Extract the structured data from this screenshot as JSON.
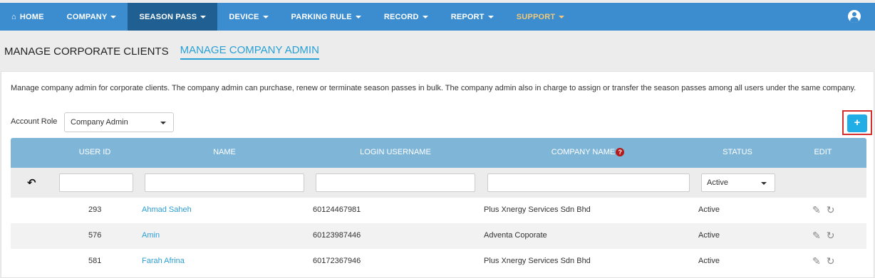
{
  "nav": {
    "items": [
      {
        "label": "HOME",
        "icon": "home-icon"
      },
      {
        "label": "COMPANY"
      },
      {
        "label": "SEASON PASS"
      },
      {
        "label": "DEVICE"
      },
      {
        "label": "PARKING RULE"
      },
      {
        "label": "RECORD"
      },
      {
        "label": "REPORT"
      },
      {
        "label": "SUPPORT"
      }
    ],
    "active": "SEASON PASS",
    "colors": {
      "bar": "#3c8dcf",
      "active": "#1f5f92",
      "support": "#f2c97a"
    }
  },
  "tabs": [
    {
      "label": "MANAGE CORPORATE CLIENTS"
    },
    {
      "label": "MANAGE COMPANY ADMIN"
    }
  ],
  "description": "Manage company admin for corporate clients. The company admin can purchase, renew or terminate season passes in bulk. The company admin also in charge to assign or transfer the season passes among all users under the same company.",
  "filters": {
    "role_label": "Account Role",
    "role_value": "Company Admin",
    "add_button": "+",
    "status_value": "Active"
  },
  "table": {
    "headers": [
      "USER ID",
      "NAME",
      "LOGIN USERNAME",
      "COMPANY NAME",
      "STATUS",
      "EDIT"
    ],
    "rows": [
      {
        "id": "293",
        "name": "Ahmad Saheh",
        "login": "60124467981",
        "company": "Plus Xnergy Services Sdn Bhd",
        "status": "Active"
      },
      {
        "id": "576",
        "name": "Amin",
        "login": "60123987446",
        "company": "Adventa Coporate",
        "status": "Active"
      },
      {
        "id": "581",
        "name": "Farah Afrina",
        "login": "60172367946",
        "company": "Plus Xnergy Services Sdn Bhd",
        "status": "Active"
      }
    ]
  }
}
